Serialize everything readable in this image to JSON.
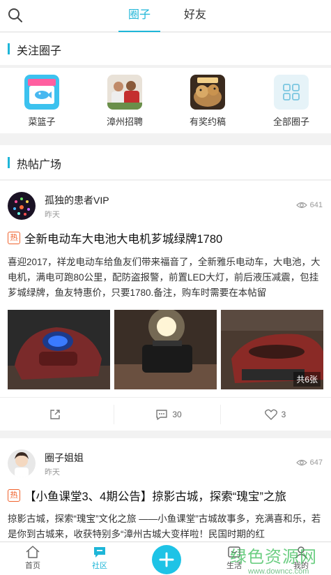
{
  "header": {
    "tabs": [
      {
        "label": "圈子",
        "active": true
      },
      {
        "label": "好友",
        "active": false
      }
    ]
  },
  "followed_circles": {
    "section_title": "关注圈子",
    "items": [
      {
        "label": "菜篮子",
        "icon": "basket-icon"
      },
      {
        "label": "漳州招聘",
        "icon": "recruit-icon"
      },
      {
        "label": "有奖约稿",
        "icon": "reward-icon"
      },
      {
        "label": "全部圈子",
        "icon": "grid-icon"
      }
    ]
  },
  "hot_posts": {
    "section_title": "热帖广场",
    "posts": [
      {
        "author": "孤独的患者VIP",
        "time": "昨天",
        "views": "641",
        "hot_badge": "热",
        "title": "全新电动车大电池大电机芗城绿牌1780",
        "body": "喜迎2017，祥龙电动车给鱼友们带来福音了，全新雅乐电动车，大电池，大电机，满电可跑80公里，配防盗报警，前置LED大灯，前后液压减震，包挂芗城绿牌，鱼友特惠价，只要1780.备注，购车时需要在本帖留",
        "photo_count": "共6张",
        "comments": "30",
        "likes": "3"
      },
      {
        "author": "圈子姐姐",
        "time": "昨天",
        "views": "647",
        "hot_badge": "热",
        "title": "【小鱼课堂3、4期公告】掠影古城，探索“瑰宝”之旅",
        "body": "掠影古城，探索“瑰宝”文化之旅 ——小鱼课堂”古城故事多，充满喜和乐，若是你到古城来，收获特别多“漳州古城大变样啦！民国时期的红"
      }
    ]
  },
  "bottom_nav": {
    "items": [
      {
        "label": "首页"
      },
      {
        "label": "社区",
        "active": true
      },
      {
        "label": "生活"
      },
      {
        "label": "我的"
      }
    ]
  },
  "watermark": {
    "line1": "绿色资源网",
    "line2": "www.downcc.com"
  },
  "colors": {
    "accent": "#1eb6d8",
    "hot": "#f0622c"
  }
}
